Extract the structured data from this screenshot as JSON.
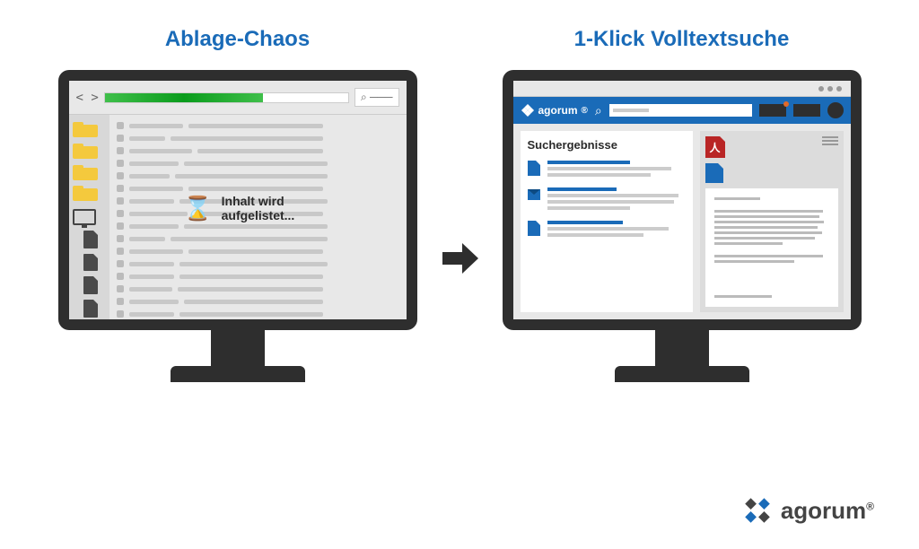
{
  "left": {
    "title": "Ablage-Chaos",
    "loading": "Inhalt wird aufgelistet...",
    "search_placeholder": "⌕"
  },
  "right": {
    "title": "1-Klick Volltextsuche",
    "brand": "agorum",
    "brand_suffix": "®",
    "results_title": "Suchergebnisse"
  },
  "footer": {
    "brand": "agorum",
    "brand_suffix": "®"
  }
}
